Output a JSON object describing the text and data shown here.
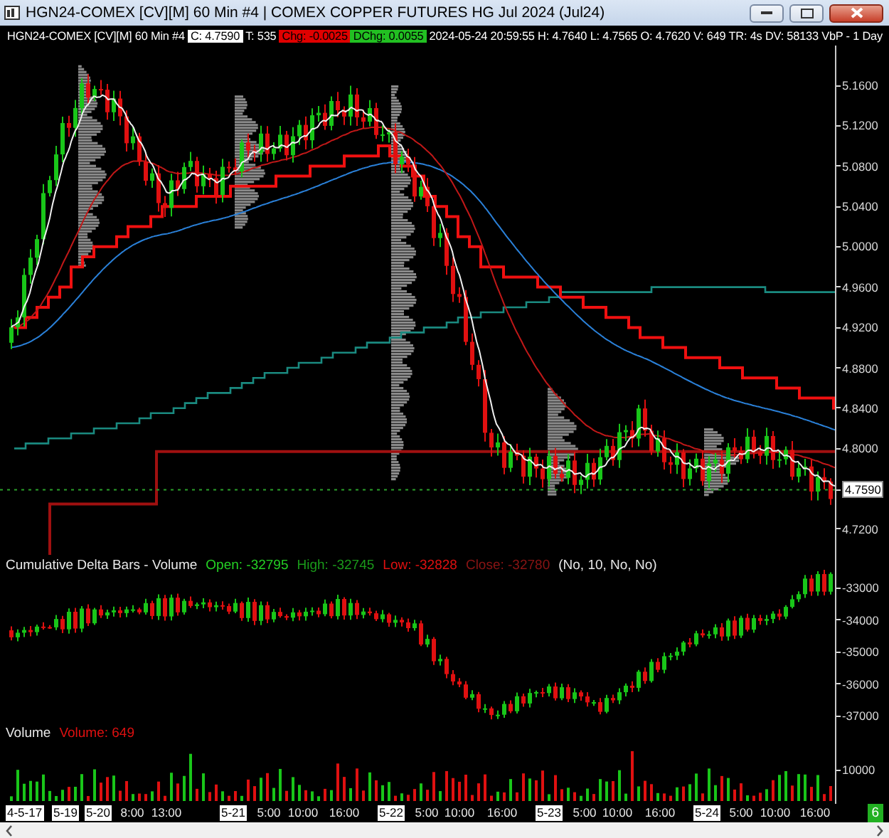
{
  "window": {
    "title": "HGN24-COMEX [CV][M]  60 Min  #4 | COMEX COPPER FUTURES HG Jul 2024 (Jul24)"
  },
  "header": {
    "symbol": "HGN24-COMEX [CV][M]  60 Min  #4",
    "fields": [
      {
        "text": "C: 4.7590",
        "kind": "last"
      },
      {
        "text": "T: 535",
        "kind": "plain"
      },
      {
        "text": "Chg: -0.0025",
        "kind": "down"
      },
      {
        "text": "DChg: 0.0055",
        "kind": "up"
      },
      {
        "text": "2024-05-24 20:59:55 H: 4.7640 L: 4.7565 O: 4.7620 V: 649 TR: 4s DV: 58133 VbP - 1 Day",
        "kind": "plain"
      }
    ]
  },
  "price_panel": {
    "axis_labels": [
      "5.1600",
      "5.1200",
      "5.0800",
      "5.0400",
      "5.0000",
      "4.9600",
      "4.9200",
      "4.8800",
      "4.8400",
      "4.8000",
      "4.7200"
    ],
    "last_price": "4.7590"
  },
  "delta_panel": {
    "title": "Cumulative Delta Bars - Volume",
    "values": [
      {
        "text": "Open: -32795",
        "kind": "open"
      },
      {
        "text": "High: -32745",
        "kind": "high"
      },
      {
        "text": "Low: -32828",
        "kind": "low"
      },
      {
        "text": "Close: -32780",
        "kind": "close"
      }
    ],
    "params": "(No, 10, No, No)",
    "axis_labels": [
      "-33000",
      "-34000",
      "-35000",
      "-36000",
      "-37000"
    ]
  },
  "volume_panel": {
    "title": "Volume",
    "value": "Volume: 649",
    "axis_labels": [
      "10000"
    ]
  },
  "time_axis": {
    "labels": [
      {
        "text": "4-5-17",
        "kind": "date"
      },
      {
        "text": "5-19",
        "kind": "date"
      },
      {
        "text": "5-20",
        "kind": "date"
      },
      {
        "text": "8:00",
        "kind": "time"
      },
      {
        "text": "13:00",
        "kind": "time"
      },
      {
        "text": "5-21",
        "kind": "date"
      },
      {
        "text": "5:00",
        "kind": "time"
      },
      {
        "text": "10:00",
        "kind": "time"
      },
      {
        "text": "16:00",
        "kind": "time"
      },
      {
        "text": "5-22",
        "kind": "date"
      },
      {
        "text": "5:00",
        "kind": "time"
      },
      {
        "text": "10:00",
        "kind": "time"
      },
      {
        "text": "16:00",
        "kind": "time"
      },
      {
        "text": "5-23",
        "kind": "date"
      },
      {
        "text": "5:00",
        "kind": "time"
      },
      {
        "text": "10:00",
        "kind": "time"
      },
      {
        "text": "16:00",
        "kind": "time"
      },
      {
        "text": "5-24",
        "kind": "date"
      },
      {
        "text": "5:00",
        "kind": "time"
      },
      {
        "text": "10:00",
        "kind": "time"
      },
      {
        "text": "16:00",
        "kind": "time"
      }
    ]
  },
  "badge": "6"
}
